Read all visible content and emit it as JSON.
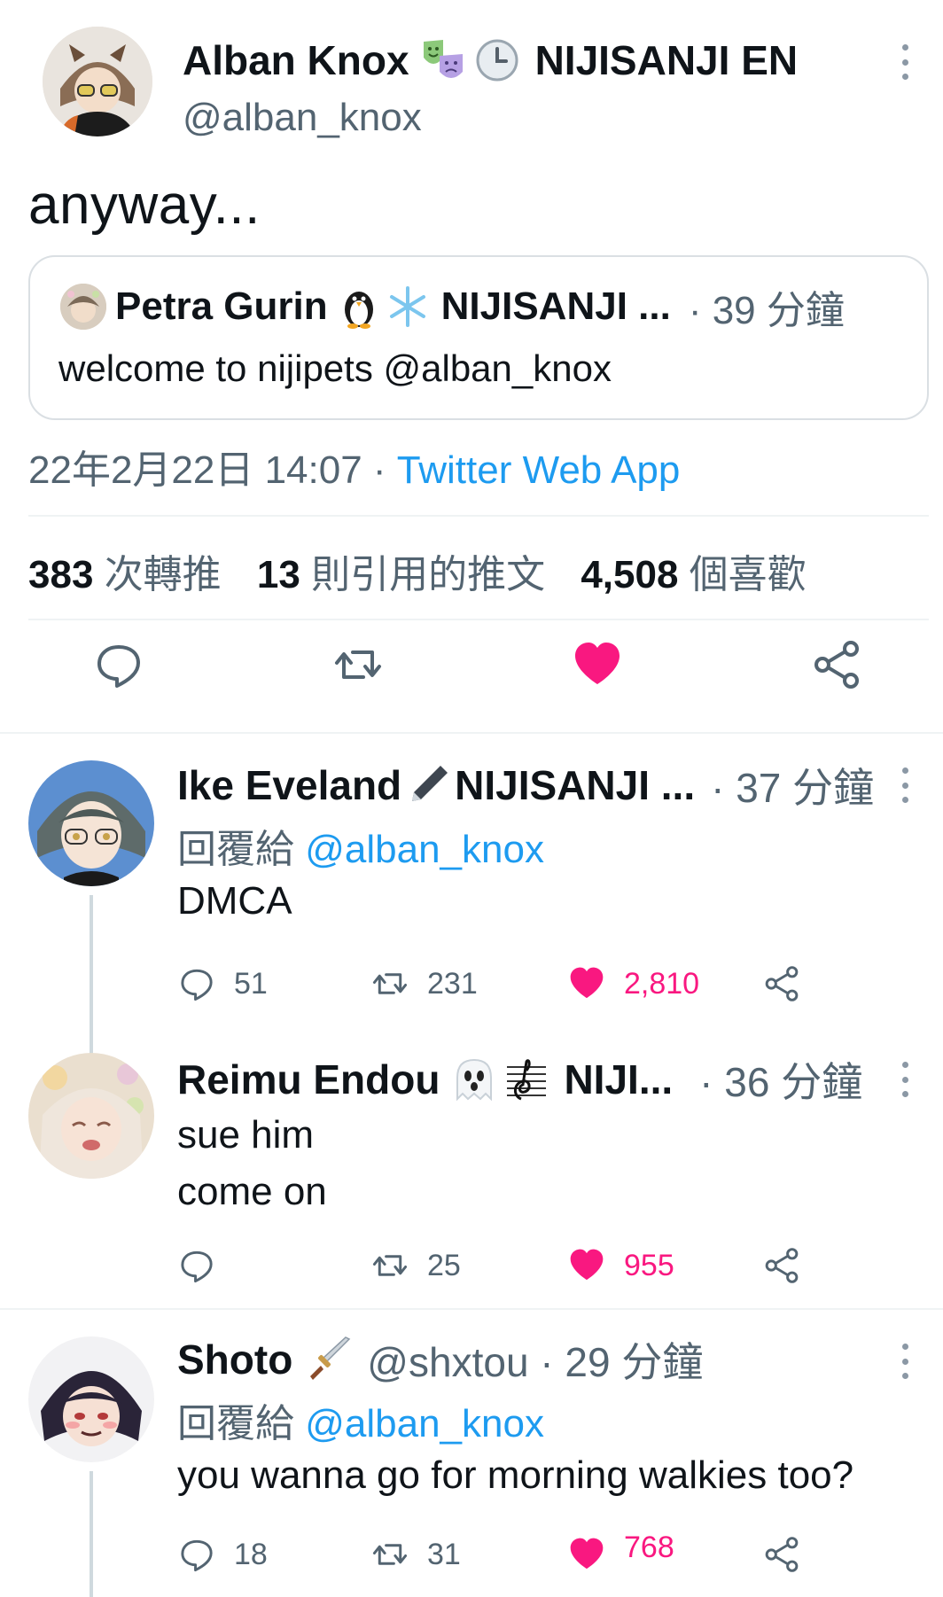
{
  "main": {
    "name": "Alban Knox",
    "badge_org": "NIJISANJI EN",
    "handle": "@alban_knox",
    "text": "anyway...",
    "quote": {
      "name": "Petra Gurin",
      "org": "NIJISANJI ...",
      "time": "· 39 分鐘",
      "text": "welcome to nijipets @alban_knox"
    },
    "meta_time": "22年2月22日 14:07 · ",
    "meta_source": "Twitter Web App",
    "stats": {
      "retweets_count": "383",
      "retweets_label": "次轉推",
      "quotes_count": "13",
      "quotes_label": "則引用的推文",
      "likes_count": "4,508",
      "likes_label": "個喜歡"
    }
  },
  "replies": [
    {
      "name": "Ike Eveland",
      "org": "NIJISANJI ...",
      "time": "· 37 分鐘",
      "reply_prefix": "回覆給 ",
      "reply_to": "@alban_knox",
      "lines": [
        "DMCA"
      ],
      "replies": "51",
      "retweets": "231",
      "likes": "2,810"
    },
    {
      "name": "Reimu Endou",
      "org": "NIJI...",
      "time": "· 36 分鐘",
      "lines": [
        "sue him",
        "come on"
      ],
      "replies": "",
      "retweets": "25",
      "likes": "955"
    },
    {
      "name": "Shoto",
      "handle_time": "@shxtou · 29 分鐘",
      "reply_prefix": "回覆給 ",
      "reply_to": "@alban_knox",
      "lines": [
        "you wanna go for morning walkies too?"
      ],
      "replies": "18",
      "retweets": "31",
      "likes": "768"
    }
  ],
  "colors": {
    "like": "#f91880",
    "link": "#1d9bf0",
    "muted": "#536471"
  },
  "icons": [
    "reply-icon",
    "retweet-icon",
    "heart-icon",
    "share-icon",
    "more-icon",
    "theater-masks-icon",
    "clock-icon",
    "penguin-icon",
    "snowflake-icon",
    "pen-icon",
    "ghost-icon",
    "music-staff-icon",
    "dagger-icon"
  ]
}
